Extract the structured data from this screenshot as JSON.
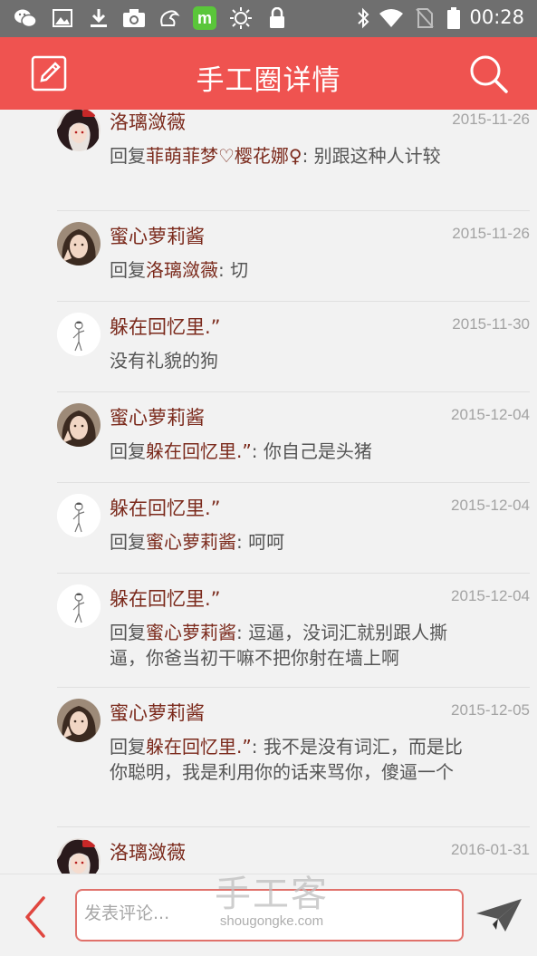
{
  "status_bar": {
    "time": "00:28",
    "left_icons": [
      "wechat-icon",
      "gallery-icon",
      "download-icon",
      "camera-icon",
      "squirrel-app-icon",
      "m-app-icon",
      "settings-sun-icon",
      "lock-icon"
    ],
    "right_icons": [
      "bluetooth-icon",
      "wifi-icon",
      "no-sim-icon",
      "battery-icon"
    ]
  },
  "header": {
    "title": "手工圈详情",
    "left_icon": "edit-icon",
    "right_icon": "search-icon",
    "background_color": "#ef5350"
  },
  "comments": [
    {
      "avatar": "avatar-anime-girl",
      "name": "洛璃潋薇",
      "date": "2015-11-26",
      "prefix": "回复",
      "reply_to": "菲萌菲梦♡樱花娜♀",
      "text": ": 别跟这种人计较"
    },
    {
      "avatar": "avatar-girl-photo",
      "name": "蜜心萝莉酱",
      "date": "2015-11-26",
      "prefix": "回复",
      "reply_to": "洛璃潋薇",
      "text": ": 切"
    },
    {
      "avatar": "avatar-sketch-figure",
      "name": "躲在回忆里.”",
      "date": "2015-11-30",
      "prefix": "",
      "reply_to": "",
      "text": "没有礼貌的狗"
    },
    {
      "avatar": "avatar-girl-photo",
      "name": "蜜心萝莉酱",
      "date": "2015-12-04",
      "prefix": "回复",
      "reply_to": "躲在回忆里.”",
      "text": ": 你自己是头猪"
    },
    {
      "avatar": "avatar-sketch-figure",
      "name": "躲在回忆里.”",
      "date": "2015-12-04",
      "prefix": "回复",
      "reply_to": "蜜心萝莉酱",
      "text": ": 呵呵"
    },
    {
      "avatar": "avatar-sketch-figure",
      "name": "躲在回忆里.”",
      "date": "2015-12-04",
      "prefix": "回复",
      "reply_to": "蜜心萝莉酱",
      "text": ": 逗逼，没词汇就别跟人撕逼，你爸当初干嘛不把你射在墙上啊"
    },
    {
      "avatar": "avatar-girl-photo",
      "name": "蜜心萝莉酱",
      "date": "2015-12-05",
      "prefix": "回复",
      "reply_to": "躲在回忆里.”",
      "text": ": 我不是没有词汇，而是比你聪明，我是利用你的话来骂你，傻逼一个"
    },
    {
      "avatar": "avatar-anime-girl",
      "name": "洛璃潋薇",
      "date": "2016-01-31",
      "prefix": "",
      "reply_to": "",
      "text": ""
    }
  ],
  "bottom_bar": {
    "back_icon": "back-chevron-icon",
    "comment_placeholder": "发表评论...",
    "comment_value": "",
    "send_icon": "send-paper-plane-icon"
  },
  "watermark": {
    "title": "手工客",
    "url": "shougongke.com"
  }
}
